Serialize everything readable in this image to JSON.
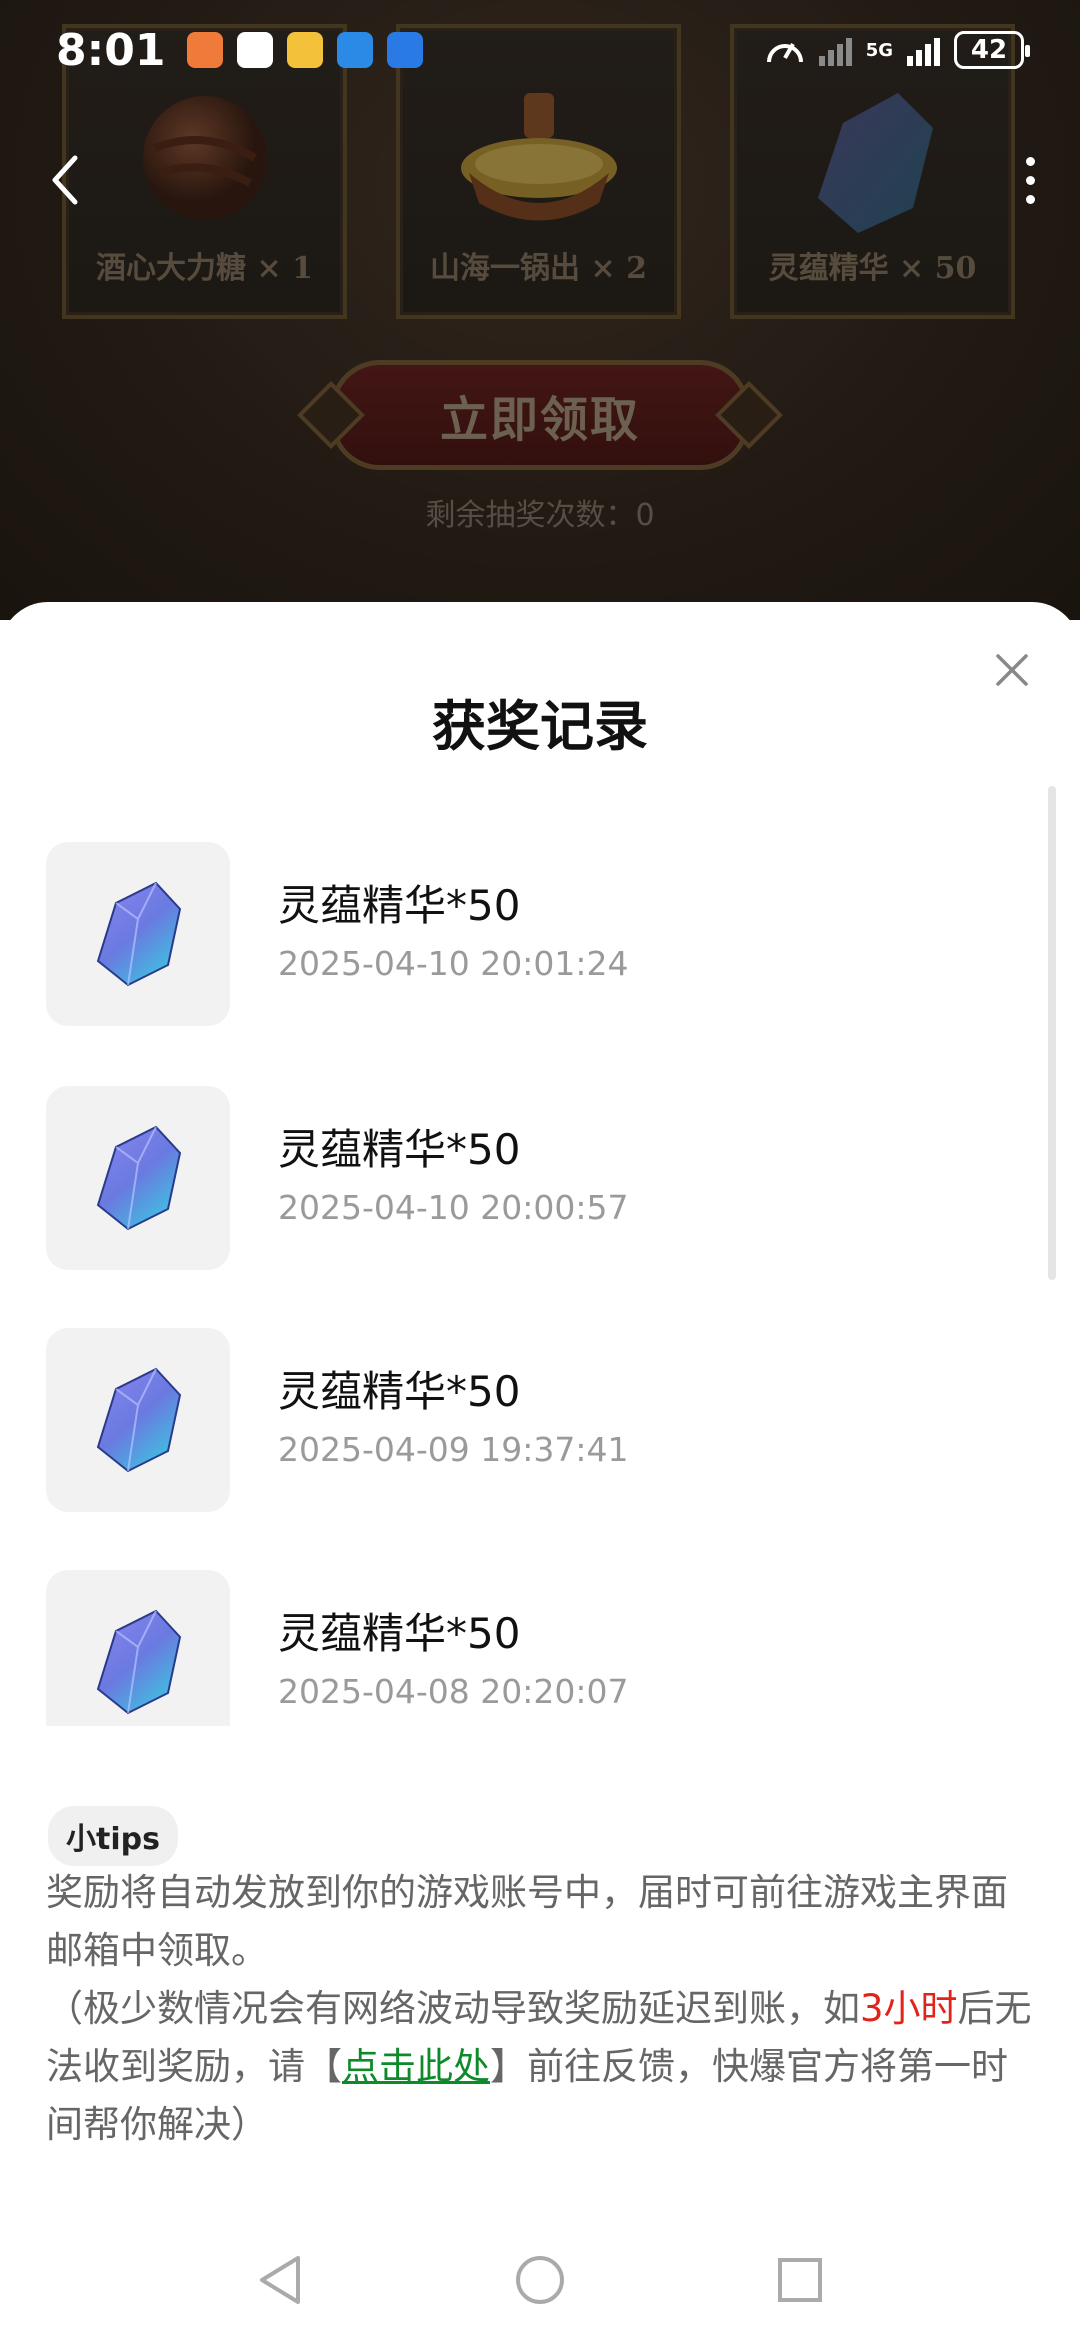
{
  "status_bar": {
    "time": "8:01",
    "network": "5G",
    "battery": "42"
  },
  "background": {
    "rewards": [
      {
        "label": "酒心大力糖 × 1"
      },
      {
        "label": "山海一锅出 × 2"
      },
      {
        "label": "灵蕴精华 × 50"
      }
    ],
    "claim_button": "立即领取",
    "remaining_text": "剩余抽奖次数：0"
  },
  "sheet": {
    "title": "获奖记录",
    "records": [
      {
        "name": "灵蕴精华*50",
        "time": "2025-04-10 20:01:24"
      },
      {
        "name": "灵蕴精华*50",
        "time": "2025-04-10 20:00:57"
      },
      {
        "name": "灵蕴精华*50",
        "time": "2025-04-09 19:37:41"
      },
      {
        "name": "灵蕴精华*50",
        "time": "2025-04-08 20:20:07"
      }
    ],
    "tips": {
      "badge": "小tips",
      "line1": "奖励将自动发放到你的游戏账号中，届时可前往游戏主界面邮箱中领取。",
      "line2_a": "（极少数情况会有网络波动导致奖励延迟到账，如",
      "line2_red": "3小时",
      "line2_b": "后无法收到奖励，请【",
      "link": "点击此处",
      "line2_c": "】前往反馈，快爆官方将第一时间帮你解决）"
    }
  },
  "colors": {
    "link": "#0f8a2a",
    "highlight": "#e2231a"
  },
  "icons": [
    "back-arrow-icon",
    "more-vertical-icon",
    "close-icon",
    "crystal-icon",
    "nav-back-icon",
    "nav-home-icon",
    "nav-recents-icon"
  ]
}
